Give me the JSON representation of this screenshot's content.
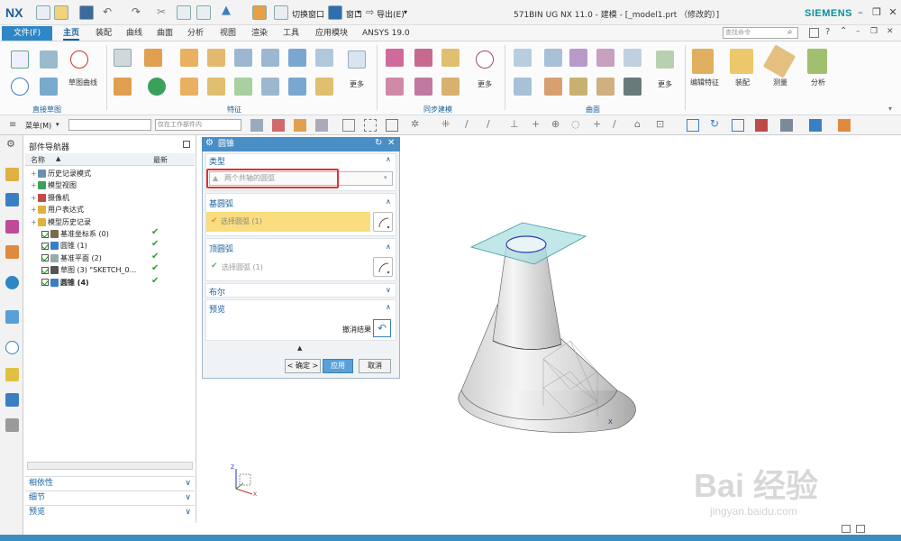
{
  "titlebar": {
    "app_logo": "NX",
    "switch_window": "切换窗口",
    "window_menu": "窗口",
    "export_menu": "导出(E)",
    "title": "571BIN UG NX 11.0 - 建模 - [_model1.prt （修改的）]",
    "brand": "SIEMENS"
  },
  "menubar": {
    "file": "文件(F)",
    "tabs": [
      "主页",
      "装配",
      "曲线",
      "曲面",
      "分析",
      "视图",
      "渲染",
      "工具",
      "应用模块",
      "ANSYS 19.0"
    ],
    "active_tab": "主页",
    "search_placeholder": "查找命令"
  },
  "ribbon": {
    "sketch_curve_label": "草图曲线",
    "more": "更多",
    "edit_feature": "编辑特征",
    "assembly": "装配",
    "measure": "测量",
    "analysis": "分析",
    "groups": [
      "直接草图",
      "特征",
      "同步建模",
      "曲面"
    ]
  },
  "toolbar2": {
    "menu": "菜单(M)",
    "filter_placeholder": "",
    "scope": "仅在工作部件内"
  },
  "navigator": {
    "title": "部件导航器",
    "col_name": "名称",
    "col_latest": "最新",
    "items": [
      {
        "label": "历史记录模式",
        "level": 0,
        "check": false,
        "tick": false,
        "icon_color": "#6a8fb0"
      },
      {
        "label": "模型视图",
        "level": 0,
        "check": false,
        "tick": false,
        "icon_color": "#3aa05a"
      },
      {
        "label": "摄像机",
        "level": 0,
        "check": false,
        "tick": false,
        "icon_color": "#c24a4a"
      },
      {
        "label": "用户表达式",
        "level": 0,
        "check": false,
        "tick": false,
        "icon_color": "#e0b040"
      },
      {
        "label": "模型历史记录",
        "level": 0,
        "check": false,
        "tick": false,
        "icon_color": "#e0b040"
      },
      {
        "label": "基准坐标系 (0)",
        "level": 1,
        "check": true,
        "tick": true,
        "icon_color": "#7a6a50"
      },
      {
        "label": "圆锥 (1)",
        "level": 1,
        "check": true,
        "tick": true,
        "icon_color": "#3a7fc4"
      },
      {
        "label": "基准平面 (2)",
        "level": 1,
        "check": true,
        "tick": true,
        "icon_color": "#9aa"
      },
      {
        "label": "草图 (3) \"SKETCH_0...",
        "level": 1,
        "check": true,
        "tick": true,
        "icon_color": "#555"
      },
      {
        "label": "圆锥 (4)",
        "level": 1,
        "check": true,
        "tick": true,
        "icon_color": "#3a7fc4",
        "bold": true
      }
    ],
    "panels": [
      "相依性",
      "细节",
      "预览"
    ]
  },
  "dialog": {
    "title": "圆锥",
    "type_header": "类型",
    "type_value": "两个共轴的圆弧",
    "base_header": "基圆弧",
    "base_value": "选择圆弧 (1)",
    "top_header": "顶圆弧",
    "top_value": "选择圆弧 (1)",
    "boolean_header": "布尔",
    "preview_header": "预览",
    "undo_result": "撤消结果",
    "ok": "< 确定 >",
    "apply": "应用",
    "cancel": "取消"
  },
  "watermark": {
    "main": "Bai 经验",
    "sub": "jingyan.baidu.com"
  },
  "colors": {
    "accent": "#1a5f9e",
    "file_tab": "#2f86c4",
    "dialog_title": "#4a8ec6",
    "selection": "#f9dd7e",
    "highlight_red": "#e03030"
  }
}
